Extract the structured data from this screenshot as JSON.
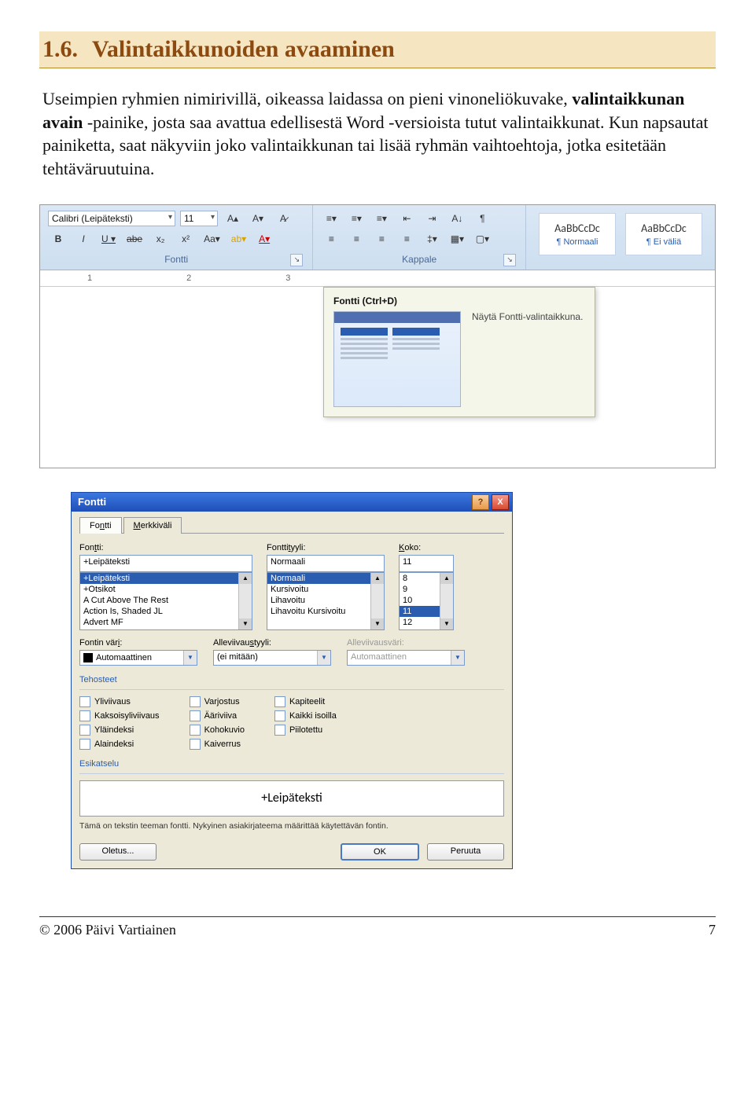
{
  "heading": {
    "number": "1.6.",
    "title": "Valintaikkunoiden avaaminen"
  },
  "paragraph": {
    "p1": "Useimpien ryhmien nimirivillä, oikeassa laidassa on pieni vinoneliökuvake, ",
    "bold": "valintaikkunan avain",
    "p2": " -painike, josta saa avattua edellisestä Word -versioista tutut valintaikkunat. Kun napsautat painiketta, saat näkyviin joko valintaikkunan tai lisää ryhmän vaihtoehtoja, jotka esitetään tehtäväruutuina."
  },
  "ribbon": {
    "fontName": "Calibri (Leipäteksti)",
    "fontSize": "11",
    "groupFont": "Fontti",
    "groupPara": "Kappale",
    "styles": [
      {
        "sample": "AaBbCcDc",
        "name": "¶ Normaali"
      },
      {
        "sample": "AaBbCcDc",
        "name": "¶ Ei väliä"
      }
    ],
    "rulerMarks": [
      "1",
      "2",
      "3"
    ],
    "tooltipTitle": "Fontti (Ctrl+D)",
    "tooltipDesc": "Näytä Fontti-valintaikkuna."
  },
  "dialog": {
    "title": "Fontti",
    "tab1": {
      "pre": "Fo",
      "u": "n",
      "post": "tti"
    },
    "tab2": {
      "pre": "",
      "u": "M",
      "post": "erkkiväli"
    },
    "labels": {
      "font": {
        "pre": "Fon",
        "u": "t",
        "post": "ti:"
      },
      "style": {
        "pre": "Fontti",
        "u": "t",
        "post": "yyli:"
      },
      "size": {
        "pre": "",
        "u": "K",
        "post": "oko:"
      },
      "fontColor": {
        "pre": "Fontin vär",
        "u": "i",
        "post": ":"
      },
      "underlineStyle": {
        "pre": "Alleviivau",
        "u": "s",
        "post": "tyyli:"
      },
      "underlineColor": "Alleviivausväri:"
    },
    "values": {
      "font": "+Leipäteksti",
      "style": "Normaali",
      "size": "11",
      "fontColor": "Automaattinen",
      "underlineStyle": "(ei mitään)",
      "underlineColor": "Automaattinen"
    },
    "fontList": [
      "+Leipäteksti",
      "+Otsikot",
      "A Cut Above The Rest",
      "Action Is, Shaded JL",
      "Advert MF"
    ],
    "styleList": [
      "Normaali",
      "Kursivoitu",
      "Lihavoitu",
      "Lihavoitu Kursivoitu"
    ],
    "sizeList": [
      "8",
      "9",
      "10",
      "11",
      "12"
    ],
    "sectionEffects": "Tehosteet",
    "sectionPreview": "Esikatselu",
    "effects": {
      "c1": [
        {
          "pre": "",
          "u": "Y",
          "post": "liviivaus"
        },
        {
          "pre": "Kaks",
          "u": "o",
          "post": "isyliviivaus"
        },
        {
          "pre": "Y",
          "u": "l",
          "post": "äindeksi"
        },
        {
          "pre": "Alain",
          "u": "d",
          "post": "eksi"
        }
      ],
      "c2": [
        {
          "pre": "V",
          "u": "a",
          "post": "rjostus"
        },
        {
          "pre": "",
          "u": "Ä",
          "post": "äriviiva"
        },
        {
          "pre": "Ko",
          "u": "h",
          "post": "okuvio"
        },
        {
          "pre": "Kai",
          "u": "v",
          "post": "errus"
        }
      ],
      "c3": [
        {
          "pre": "Kapit",
          "u": "e",
          "post": "elit"
        },
        {
          "pre": "Kai",
          "u": "k",
          "post": "ki isoilla"
        },
        {
          "pre": "",
          "u": "P",
          "post": "iilotettu"
        }
      ]
    },
    "previewText": "+Leipäteksti",
    "previewNote": "Tämä on tekstin teeman fontti. Nykyinen asiakirjateema määrittää käytettävän fontin.",
    "buttons": {
      "default": "Oletus...",
      "ok": "OK",
      "cancel": "Peruuta"
    }
  },
  "footer": {
    "copy": "© 2006 Päivi Vartiainen",
    "page": "7"
  }
}
